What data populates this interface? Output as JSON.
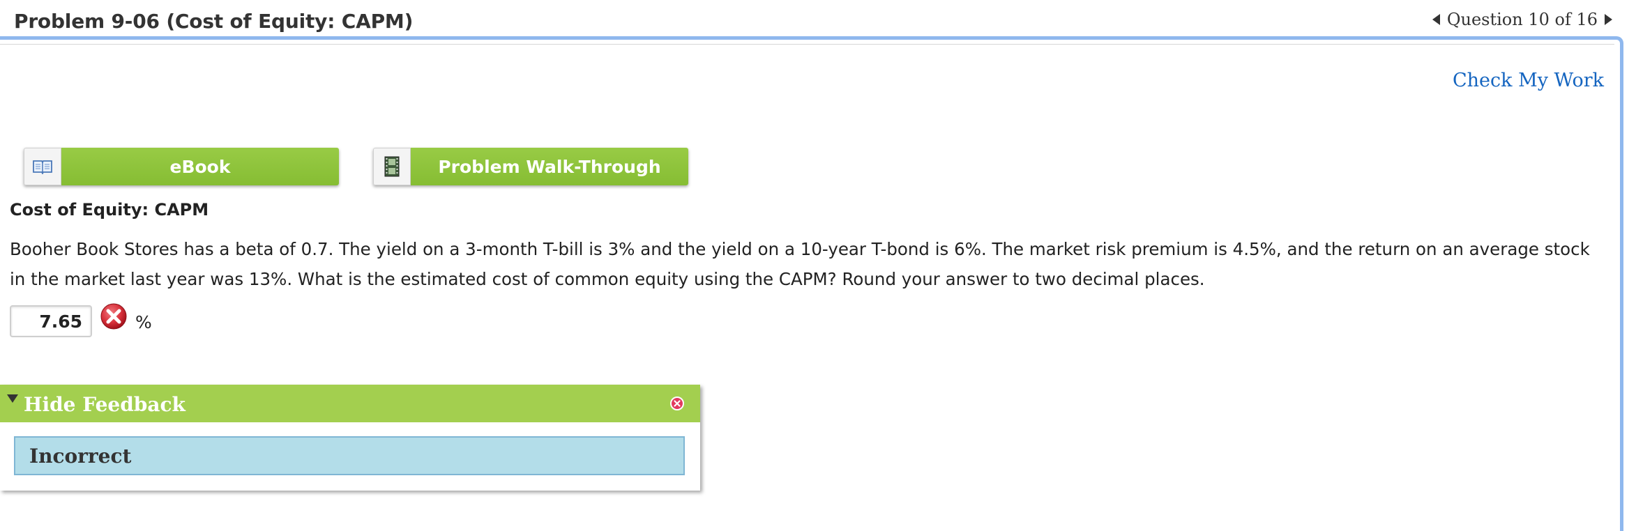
{
  "header": {
    "title": "Problem 9-06 (Cost of Equity: CAPM)",
    "question_nav": "Question 10 of 16"
  },
  "actions": {
    "check_my_work": "Check My Work"
  },
  "resources": {
    "ebook_label": "eBook",
    "walkthrough_label": "Problem Walk-Through"
  },
  "problem": {
    "subheading": "Cost of Equity: CAPM",
    "text": "Booher Book Stores has a beta of 0.7. The yield on a 3-month T-bill is 3% and the yield on a 10-year T-bond is 6%. The market risk premium is 4.5%, and the return on an average stock in the market last year was 13%. What is the estimated cost of common equity using the CAPM? Round your answer to two decimal places."
  },
  "answer": {
    "value": "7.65",
    "unit": "%",
    "status_icon": "incorrect-x-icon"
  },
  "feedback": {
    "toggle_label": "Hide Feedback",
    "result": "Incorrect"
  },
  "colors": {
    "accent_green": "#98cb45",
    "link_blue": "#1565c0",
    "frame_blue": "#8fb8ee",
    "feedback_blue": "#b3dde9",
    "error_red": "#d9323c"
  }
}
